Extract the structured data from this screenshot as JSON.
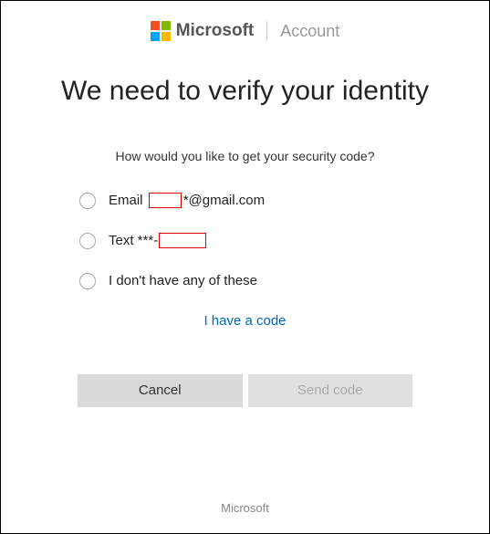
{
  "header": {
    "brand": "Microsoft",
    "section": "Account"
  },
  "title": "We need to verify your identity",
  "prompt": "How would you like to get your security code?",
  "options": {
    "email_prefix": "Email ",
    "email_suffix": "*@gmail.com",
    "text_prefix": "Text ***-",
    "none": "I don't have any of these"
  },
  "have_code": "I have a code",
  "buttons": {
    "cancel": "Cancel",
    "send": "Send code"
  },
  "footer": "Microsoft"
}
